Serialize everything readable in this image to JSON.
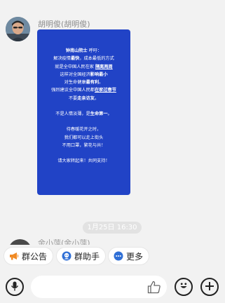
{
  "message": {
    "sender_name": "胡明俊(胡明俊)",
    "card_lines": [
      [
        {
          "t": "钟南山院士",
          "s": "b"
        },
        {
          "t": " 呼吁：",
          "s": ""
        }
      ],
      [
        {
          "t": "解决疫情",
          "s": ""
        },
        {
          "t": "最快",
          "s": "b"
        },
        {
          "t": "，成本最低的方式",
          "s": ""
        }
      ],
      [
        {
          "t": "就是全中国人民在家 ",
          "s": ""
        },
        {
          "t": "隔离两周",
          "s": "u"
        }
      ],
      [
        {
          "t": "这样对全国经济",
          "s": ""
        },
        {
          "t": "影响最小",
          "s": "b"
        }
      ],
      [
        {
          "t": "对生命健康",
          "s": ""
        },
        {
          "t": "最有利",
          "s": "b"
        },
        {
          "t": "。",
          "s": ""
        }
      ],
      [
        {
          "t": "强烈建议全中国人民都",
          "s": ""
        },
        {
          "t": "在家过春节",
          "s": "u"
        }
      ],
      [
        {
          "t": "不要",
          "s": ""
        },
        {
          "t": "走亲访友",
          "s": "b"
        },
        {
          "t": "。",
          "s": ""
        }
      ],
      [],
      [
        {
          "t": "不是人情淡薄，是",
          "s": ""
        },
        {
          "t": "生命第一",
          "s": "b"
        },
        {
          "t": "。",
          "s": ""
        }
      ],
      [],
      [
        {
          "t": "待春暖花开之时，",
          "s": ""
        }
      ],
      [
        {
          "t": "我们都可以走上街头",
          "s": ""
        }
      ],
      [
        {
          "t": "不用口罩，繁花与共！",
          "s": ""
        }
      ],
      [],
      [
        {
          "t": "请大家转起来！共同支持！",
          "s": ""
        }
      ]
    ]
  },
  "timestamp": "1月25日 16:30",
  "next_sender_partial": "余小萍(余小萍)",
  "quick_actions": [
    {
      "label": "群公告",
      "icon": "megaphone-icon",
      "color": "#f08a24"
    },
    {
      "label": "群助手",
      "icon": "assistant-icon",
      "color": "#2f6fd6"
    },
    {
      "label": "更多",
      "icon": "more-icon",
      "color": "#2f6fd6"
    }
  ],
  "input_bar": {
    "icons": [
      "voice-icon",
      "like-icon",
      "emoji-icon",
      "plus-icon"
    ]
  }
}
